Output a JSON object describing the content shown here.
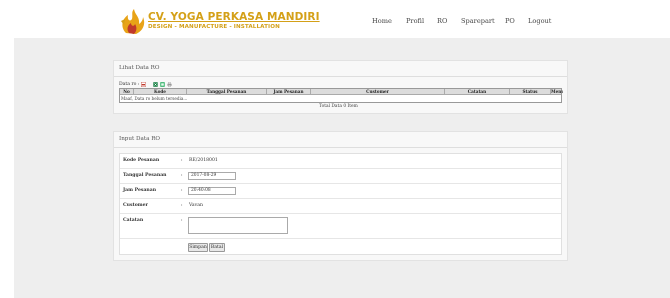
{
  "brand": {
    "name": "CV. YOGA PERKASA MANDIRI",
    "tagline": "DESIGN - MANUFACTURE - INSTALLATION",
    "accent_color": "#d4a017"
  },
  "nav": {
    "items": [
      "Home",
      "Profil",
      "RO",
      "Sparepart",
      "PO",
      "Logout"
    ]
  },
  "lihat": {
    "title": "Lihat Data RO",
    "label": "Data ro :",
    "toolbar_icons": [
      "pdf-icon",
      "excel-icon",
      "word-icon",
      "print-icon"
    ],
    "columns": [
      "No",
      "Kode",
      "Tanggal Pesanan",
      "Jam Pesanan",
      "Customer",
      "Catatan",
      "Status",
      "Menu"
    ],
    "empty_message": "Maaf, Data ro belum tersedia...",
    "total_text": "Total Data 0 Item"
  },
  "input": {
    "title": "Input Data RO",
    "fields": {
      "kode_label": "Kode Pesanan",
      "kode_value": "RE/2018001",
      "tanggal_label": "Tanggal Pesanan",
      "tanggal_value": "2017-08-29",
      "jam_label": "Jam Pesanan",
      "jam_value": "20:40:08",
      "customer_label": "Customer",
      "customer_value": "Vavan",
      "catatan_label": "Catatan"
    },
    "colon": ":",
    "buttons": {
      "save": "Simpan",
      "cancel": "Batal"
    }
  }
}
